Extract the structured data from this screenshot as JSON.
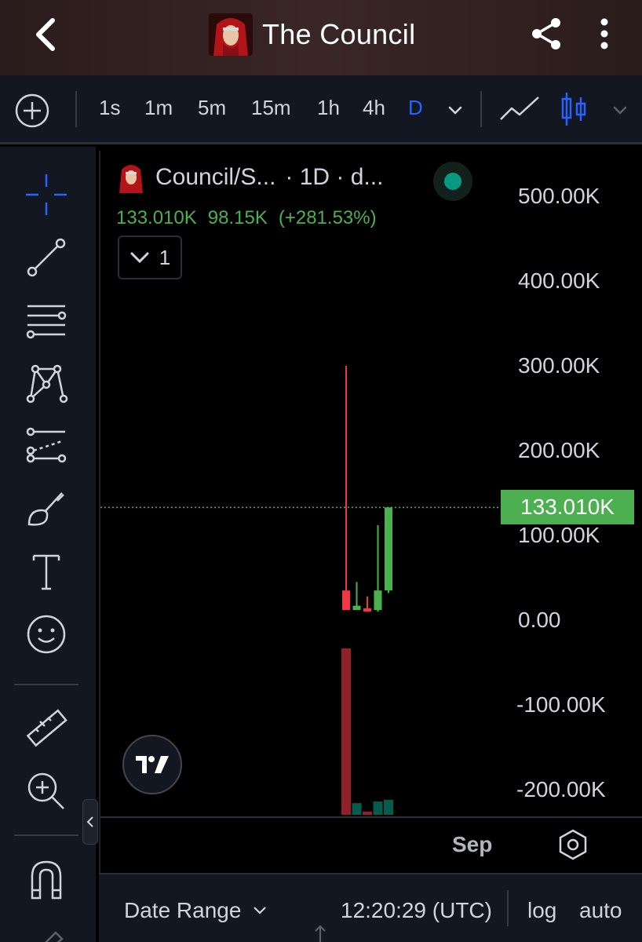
{
  "header": {
    "title": "The Council",
    "back_icon": "back-arrow-icon",
    "share_icon": "share-icon",
    "more_icon": "more-vertical-icon"
  },
  "toolbar": {
    "timeframes": [
      "1s",
      "1m",
      "5m",
      "15m",
      "1h",
      "4h",
      "D"
    ],
    "active_timeframe": "D"
  },
  "sidebar": {
    "tools": [
      "crosshair-icon",
      "trend-line-icon",
      "fib-levels-icon",
      "pattern-icon",
      "projection-icon",
      "brush-icon",
      "text-icon",
      "emoji-icon",
      "ruler-icon",
      "zoom-in-icon",
      "magnet-icon",
      "pencil-icon"
    ]
  },
  "legend": {
    "symbol": "Council/S...",
    "interval": "· 1D · d...",
    "price": "133.010K",
    "change": "98.15K",
    "change_pct": "(+281.53%)",
    "collapse_count": "1"
  },
  "chart_data": {
    "type": "candlestick",
    "y_axis_labels": [
      "500.00K",
      "400.00K",
      "300.00K",
      "200.00K",
      "100.00K",
      "0.00",
      "-100.00K",
      "-200.00K"
    ],
    "ylim": [
      -220000,
      520000
    ],
    "last_price": 133010,
    "last_price_label": "133.010K",
    "x_labels": [
      "Sep"
    ],
    "candles": [
      {
        "open": 35000,
        "high": 300000,
        "low": 12000,
        "close": 12000,
        "color": "#f23645"
      },
      {
        "open": 17000,
        "high": 45000,
        "low": 15000,
        "close": 12000,
        "color": "#4caf50"
      },
      {
        "open": 14000,
        "high": 28000,
        "low": 10000,
        "close": 10000,
        "color": "#f23645"
      },
      {
        "open": 12000,
        "high": 112000,
        "low": 10000,
        "close": 35000,
        "color": "#4caf50"
      },
      {
        "open": 35000,
        "high": 133010,
        "low": 32000,
        "close": 133010,
        "color": "#4caf50"
      }
    ],
    "volumes": [
      {
        "value": 1.0,
        "color": "#f23645"
      },
      {
        "value": 0.07,
        "color": "#089981"
      },
      {
        "value": 0.02,
        "color": "#f23645"
      },
      {
        "value": 0.08,
        "color": "#089981"
      },
      {
        "value": 0.09,
        "color": "#089981"
      }
    ]
  },
  "bottom_bar": {
    "date_range": "Date Range",
    "time": "12:20:29 (UTC)",
    "log": "log",
    "auto": "auto"
  },
  "colors": {
    "up": "#4caf50",
    "down": "#f23645",
    "accent": "#2962ff",
    "background": "#000000",
    "panel": "#131722"
  }
}
